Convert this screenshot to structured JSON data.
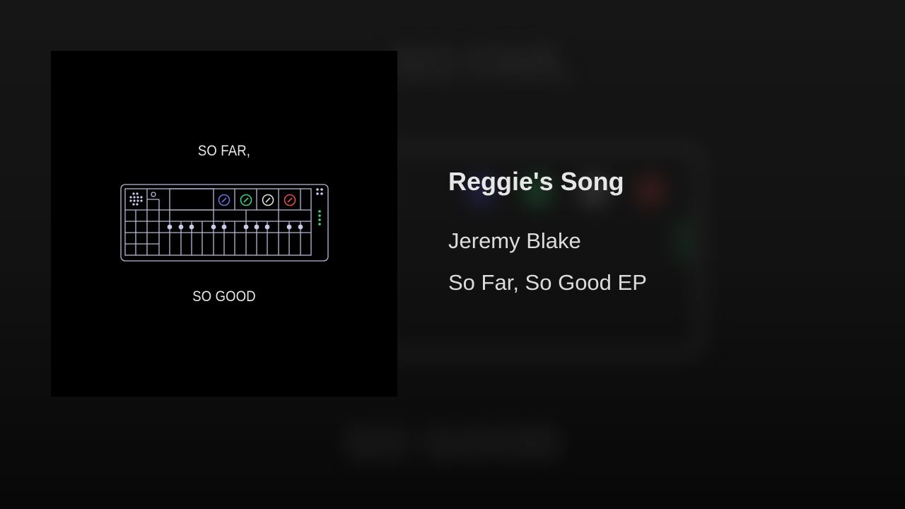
{
  "album_art": {
    "top_text": "SO FAR,",
    "bottom_text": "SO GOOD",
    "device_icon": "synth-sequencer-icon",
    "colors": {
      "outline": "#b8b8d8",
      "dot": "#c9c9ee",
      "knob_blue": "#6f6fd8",
      "knob_green": "#3fcf7a",
      "knob_white": "#e0e0e0",
      "knob_red": "#e0504a",
      "led_green": "#40d07a"
    }
  },
  "track": {
    "title": "Reggie's Song",
    "artist": "Jeremy Blake",
    "album": "So Far, So Good EP"
  }
}
